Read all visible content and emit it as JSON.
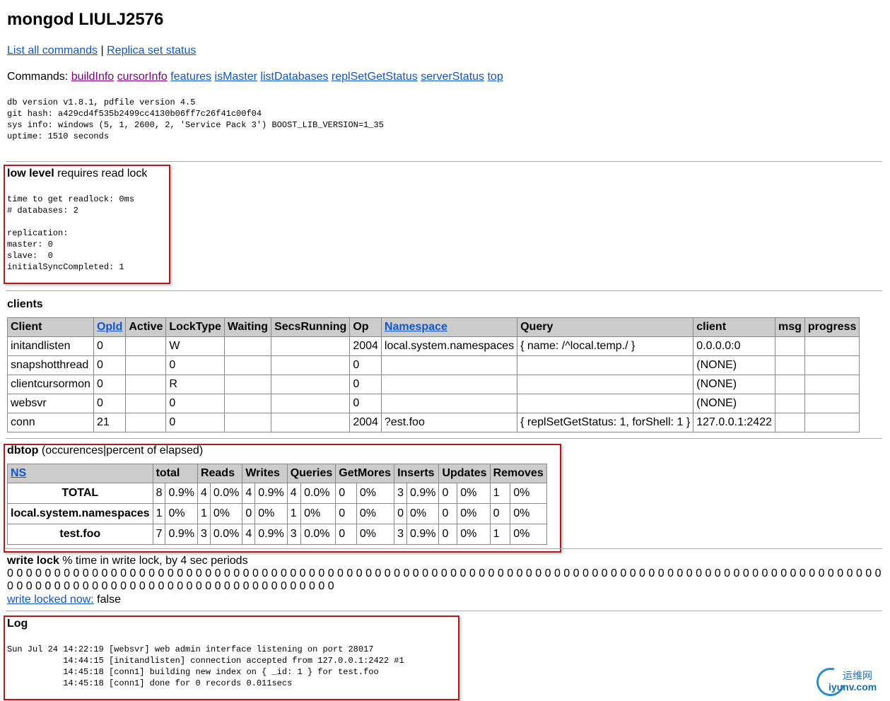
{
  "title": "mongod LIULJ2576",
  "top_links": {
    "list_all_commands": "List all commands",
    "separator": "|",
    "replica_set_status": "Replica set status"
  },
  "commands": {
    "label": "Commands:",
    "items": [
      "buildInfo",
      "cursorInfo",
      "features",
      "isMaster",
      "listDatabases",
      "replSetGetStatus",
      "serverStatus",
      "top"
    ]
  },
  "build_info": "db version v1.8.1, pdfile version 4.5\ngit hash: a429cd4f535b2499cc4130b06ff7c26f41c00f04\nsys info: windows (5, 1, 2600, 2, 'Service Pack 3') BOOST_LIB_VERSION=1_35\nuptime: 1510 seconds",
  "low_level": {
    "title": "low level",
    "subtitle": " requires read lock",
    "body": "time to get readlock: 0ms\n# databases: 2\n\nreplication:\nmaster: 0\nslave:  0\ninitialSyncCompleted: 1"
  },
  "clients": {
    "title": "clients",
    "headers": [
      "Client",
      "OpId",
      "Active",
      "LockType",
      "Waiting",
      "SecsRunning",
      "Op",
      "Namespace",
      "Query",
      "client",
      "msg",
      "progress"
    ],
    "rows": [
      [
        "initandlisten",
        "0",
        "",
        "W",
        "",
        "",
        "2004",
        "local.system.namespaces",
        "{ name: /^local.temp./ }",
        "0.0.0.0:0",
        "",
        ""
      ],
      [
        "snapshotthread",
        "0",
        "",
        "0",
        "",
        "",
        "0",
        "",
        "",
        "(NONE)",
        "",
        ""
      ],
      [
        "clientcursormon",
        "0",
        "",
        "R",
        "",
        "",
        "0",
        "",
        "",
        "(NONE)",
        "",
        ""
      ],
      [
        "websvr",
        "0",
        "",
        "0",
        "",
        "",
        "0",
        "",
        "",
        "(NONE)",
        "",
        ""
      ],
      [
        "conn",
        "21",
        "",
        "0",
        "",
        "",
        "2004",
        "?est.foo",
        "{ replSetGetStatus: 1, forShell: 1 }",
        "127.0.0.1:2422",
        "",
        ""
      ]
    ]
  },
  "dbtop": {
    "title": "dbtop",
    "subtitle": " (occurences|percent of elapsed)",
    "headers": [
      "NS",
      "total",
      "Reads",
      "Writes",
      "Queries",
      "GetMores",
      "Inserts",
      "Updates",
      "Removes"
    ],
    "rows": [
      {
        "ns": "TOTAL",
        "cells": [
          "8",
          "0.9%",
          "4",
          "0.0%",
          "4",
          "0.9%",
          "4",
          "0.0%",
          "0",
          "0%",
          "3",
          "0.9%",
          "0",
          "0%",
          "1",
          "0%"
        ]
      },
      {
        "ns": "local.system.namespaces",
        "cells": [
          "1",
          "0%",
          "1",
          "0%",
          "0",
          "0%",
          "1",
          "0%",
          "0",
          "0%",
          "0",
          "0%",
          "0",
          "0%",
          "0",
          "0%"
        ]
      },
      {
        "ns": "test.foo",
        "cells": [
          "7",
          "0.9%",
          "3",
          "0.0%",
          "4",
          "0.9%",
          "3",
          "0.0%",
          "0",
          "0%",
          "3",
          "0.9%",
          "0",
          "0%",
          "1",
          "0%"
        ]
      }
    ]
  },
  "write_lock": {
    "title": "write lock",
    "subtitle": " % time in write lock, by 4 sec periods",
    "values": "0 0 0 0 0 0 0 0 0 0 0 0 0 0 0 0 0 0 0 0 0 0 0 0 0 0 0 0 0 0 0 0 0 0 0 0 0 0 0 0 0 0 0 0 0 0 0 0 0 0 0 0 0 0 0 0 0 0 0 0 0 0 0 0 0 0 0 0 0 0 0 0 0 0 0 0 0 0 0 0 0 0 0 0 0 0 0 0 0 0 0 0 0 0 0 0 0 0 0 0 0 0 0 0 0 0 0 0 0 0 0 0 0 0 0 0 0 0 0 0 0 0 0 0 0 0 0 0",
    "now_link": "write locked now:",
    "now_value": " false"
  },
  "log": {
    "title": "Log",
    "body": "Sun Jul 24 14:22:19 [websvr] web admin interface listening on port 28017\n           14:44:15 [initandlisten] connection accepted from 127.0.0.1:2422 #1\n           14:45:18 [conn1] building new index on { _id: 1 } for test.foo\n           14:45:18 [conn1] done for 0 records 0.011secs"
  },
  "watermark": {
    "cn": "运维网",
    "en": "iyunv.com"
  },
  "colors": {
    "link": "#1155cc",
    "visited_link": "#800080",
    "highlight_box": "#b01c1c",
    "header_bg": "#cccccc"
  }
}
